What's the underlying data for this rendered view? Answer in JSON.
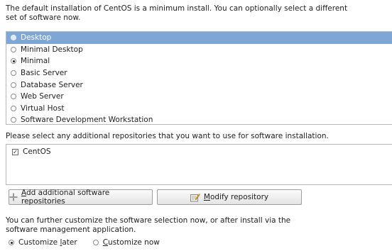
{
  "intro_text": "The default installation of CentOS is a minimum install. You can optionally select a different set of software now.",
  "software_sets": [
    {
      "label": "Desktop",
      "selected": true,
      "checked": false
    },
    {
      "label": "Minimal Desktop",
      "selected": false,
      "checked": false
    },
    {
      "label": "Minimal",
      "selected": false,
      "checked": true
    },
    {
      "label": "Basic Server",
      "selected": false,
      "checked": false
    },
    {
      "label": "Database Server",
      "selected": false,
      "checked": false
    },
    {
      "label": "Web Server",
      "selected": false,
      "checked": false
    },
    {
      "label": "Virtual Host",
      "selected": false,
      "checked": false
    },
    {
      "label": "Software Development Workstation",
      "selected": false,
      "checked": false
    }
  ],
  "repos_label": "Please select any additional repositories that you want to use for software installation.",
  "repos": [
    {
      "label": "CentOS",
      "checked": true
    }
  ],
  "buttons": {
    "add_mnemonic": "A",
    "add_rest": "dd additional software repositories",
    "modify_mnemonic": "M",
    "modify_rest": "odify repository"
  },
  "customize_text": "You can further customize the software selection now, or after install via the software management application.",
  "customize_options": {
    "later_prefix": "Customize ",
    "later_mnemonic": "l",
    "later_rest": "ater",
    "now_mnemonic": "C",
    "now_rest": "ustomize now",
    "selected": "later"
  },
  "colors": {
    "selection": "#7fa7d6"
  }
}
